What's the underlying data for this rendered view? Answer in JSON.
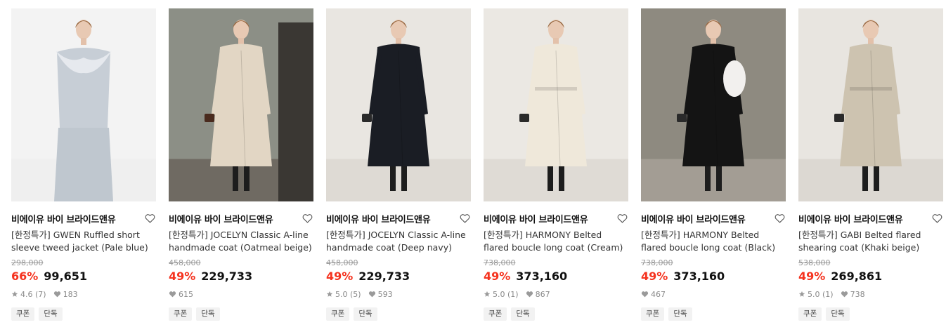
{
  "products": [
    {
      "brand": "비에이유 바이 브라이드앤유",
      "title": "[한정특가] GWEN Ruffled short sleeve tweed jacket (Pale blue)",
      "original_price": "298,000",
      "discount": "66%",
      "price": "99,651",
      "rating": "4.6 (7)",
      "likes": "183",
      "tags": [
        "쿠폰",
        "단독"
      ],
      "image": {
        "bg": "#f3f3f3",
        "floor": "#efefef",
        "garment": "#c7ced6",
        "accent": "#e6e9ee"
      }
    },
    {
      "brand": "비에이유 바이 브라이드앤유",
      "title": "[한정특가] JOCELYN Classic A-line handmade coat (Oatmeal beige)",
      "original_price": "458,000",
      "discount": "49%",
      "price": "229,733",
      "rating": "",
      "likes": "615",
      "tags": [
        "쿠폰",
        "단독"
      ],
      "image": {
        "bg": "#8c8f86",
        "floor": "#6f6a62",
        "garment": "#e2d6c4",
        "accent": "#3a3733"
      }
    },
    {
      "brand": "비에이유 바이 브라이드앤유",
      "title": "[한정특가] JOCELYN Classic A-line handmade coat (Deep navy)",
      "original_price": "458,000",
      "discount": "49%",
      "price": "229,733",
      "rating": "5.0 (5)",
      "likes": "593",
      "tags": [
        "쿠폰",
        "단독"
      ],
      "image": {
        "bg": "#e9e6e1",
        "floor": "#dedad4",
        "garment": "#1a1d24",
        "accent": "#6c6a68"
      }
    },
    {
      "brand": "비에이유 바이 브라이드앤유",
      "title": "[한정특가] HARMONY Belted flared boucle long coat (Cream)",
      "original_price": "738,000",
      "discount": "49%",
      "price": "373,160",
      "rating": "5.0 (1)",
      "likes": "867",
      "tags": [
        "쿠폰",
        "단독"
      ],
      "image": {
        "bg": "#ebe8e3",
        "floor": "#dfdbd5",
        "garment": "#efe8da",
        "accent": "#1c1c1c"
      }
    },
    {
      "brand": "비에이유 바이 브라이드앤유",
      "title": "[한정특가] HARMONY Belted flared boucle long coat (Black)",
      "original_price": "738,000",
      "discount": "49%",
      "price": "373,160",
      "rating": "",
      "likes": "467",
      "tags": [
        "쿠폰",
        "단독"
      ],
      "image": {
        "bg": "#8e8a80",
        "floor": "#a39d94",
        "garment": "#141414",
        "accent": "#f2f0ee"
      }
    },
    {
      "brand": "비에이유 바이 브라이드앤유",
      "title": "[한정특가] GABI Belted flared shearing coat (Khaki beige)",
      "original_price": "538,000",
      "discount": "49%",
      "price": "269,861",
      "rating": "5.0 (1)",
      "likes": "738",
      "tags": [
        "쿠폰",
        "단독"
      ],
      "image": {
        "bg": "#e8e5e0",
        "floor": "#dcd8d2",
        "garment": "#cdc3b0",
        "accent": "#1c1c1c"
      }
    }
  ],
  "colors": {
    "discount": "#f5331f",
    "text": "#111111",
    "muted": "#888888"
  }
}
